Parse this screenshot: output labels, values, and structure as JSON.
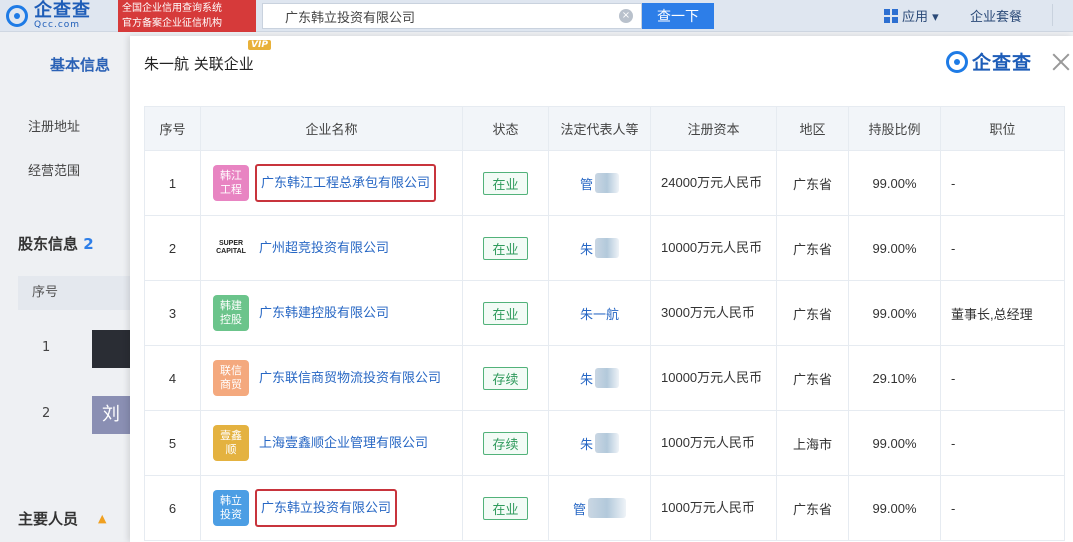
{
  "topbar": {
    "logo_cn": "企查查",
    "logo_en": "Qcc.com",
    "promo_line1": "全国企业信用查询系统",
    "promo_line2": "官方备案企业征信机构",
    "search_value": "广东韩立投资有限公司",
    "search_button": "查一下",
    "app_menu": "应用 ▾",
    "housekeeper": "企业套餐"
  },
  "background": {
    "tab_basic": "基本信息",
    "reg_address": "注册地址",
    "business_scope": "经营范围",
    "shareholder_info": "股东信息",
    "shareholder_count": "2",
    "seq_header": "序号",
    "row1_num": "1",
    "row2_num": "2",
    "row2_avatar": "刘",
    "key_personnel": "主要人员"
  },
  "modal": {
    "title": "朱一航 关联企业",
    "vip": "VIP",
    "logo_text": "企查查",
    "columns": [
      "序号",
      "企业名称",
      "状态",
      "法定代表人等",
      "注册资本",
      "地区",
      "持股比例",
      "职位"
    ],
    "rows": [
      {
        "seq": "1",
        "logo": "韩江工程",
        "logo_color": "pink",
        "name": "广东韩江工程总承包有限公司",
        "highlight": true,
        "status": "在业",
        "legal": "管",
        "legal_blur": true,
        "capital": "24000万元人民币",
        "region": "广东省",
        "ratio": "99.00%",
        "position": "-"
      },
      {
        "seq": "2",
        "logo": "SUPER CAPITAL",
        "logo_color": "brand",
        "name": "广州超竞投资有限公司",
        "highlight": false,
        "status": "在业",
        "legal": "朱",
        "legal_blur": true,
        "capital": "10000万元人民币",
        "region": "广东省",
        "ratio": "99.00%",
        "position": "-"
      },
      {
        "seq": "3",
        "logo": "韩建控股",
        "logo_color": "green",
        "name": "广东韩建控股有限公司",
        "highlight": false,
        "status": "在业",
        "legal": "朱一航",
        "legal_blur": false,
        "capital": "3000万元人民币",
        "region": "广东省",
        "ratio": "99.00%",
        "position": "董事长,总经理"
      },
      {
        "seq": "4",
        "logo": "联信商贸",
        "logo_color": "peach",
        "name": "广东联信商贸物流投资有限公司",
        "highlight": false,
        "status": "存续",
        "legal": "朱",
        "legal_blur": true,
        "capital": "10000万元人民币",
        "region": "广东省",
        "ratio": "29.10%",
        "position": "-"
      },
      {
        "seq": "5",
        "logo": "壹鑫顺",
        "logo_color": "gold",
        "name": "上海壹鑫顺企业管理有限公司",
        "highlight": false,
        "status": "存续",
        "legal": "朱",
        "legal_blur": true,
        "capital": "1000万元人民币",
        "region": "上海市",
        "ratio": "99.00%",
        "position": "-"
      },
      {
        "seq": "6",
        "logo": "韩立投资",
        "logo_color": "blue",
        "name": "广东韩立投资有限公司",
        "highlight": true,
        "status": "在业",
        "legal": "管",
        "legal_blur": true,
        "capital": "1000万元人民币",
        "region": "广东省",
        "ratio": "99.00%",
        "position": "-"
      }
    ]
  }
}
